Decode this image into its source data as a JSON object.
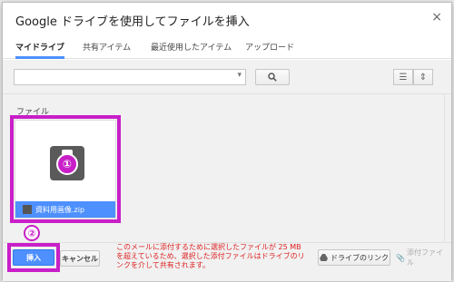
{
  "dialog": {
    "title": "Google ドライブを使用してファイルを挿入",
    "close_symbol": "×"
  },
  "tabs": [
    {
      "label": "マイドライブ",
      "active": true
    },
    {
      "label": "共有アイテム",
      "active": false
    },
    {
      "label": "最近使用したアイテム",
      "active": false
    },
    {
      "label": "アップロード",
      "active": false
    }
  ],
  "search": {
    "value": "",
    "placeholder": ""
  },
  "section": {
    "label": "ファイル"
  },
  "file": {
    "name": "資料用画像.zip",
    "icon": "zip-icon"
  },
  "annotations": {
    "step1": "①",
    "step2": "②",
    "highlight_color": "#c81fc8"
  },
  "footer": {
    "insert_label": "挿入",
    "cancel_label": "キャンセル",
    "warning": "このメールに添付するために選択したファイルが 25 MB を超えているため、選択した添付ファイルはドライブのリンクを介して共有されます。",
    "drive_link_label": "ドライブのリンク",
    "attach_label": "添付ファイル"
  },
  "colors": {
    "accent": "#4d90fe",
    "warning": "#dd2222"
  }
}
